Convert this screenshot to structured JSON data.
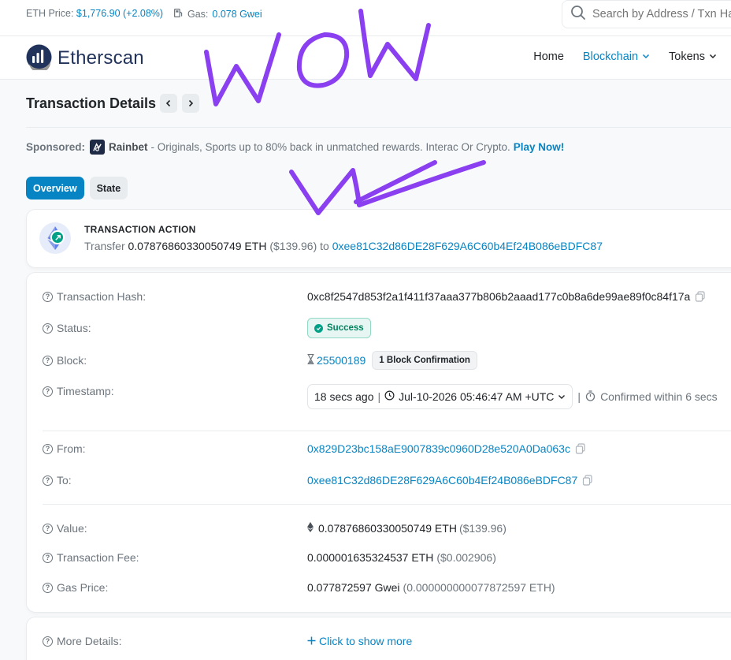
{
  "topbar": {
    "eth_price_label": "ETH Price:",
    "eth_price_value": "$1,776.90 (+2.08%)",
    "gas_label": "Gas:",
    "gas_value": "0.078 Gwei",
    "search_placeholder": "Search by Address / Txn Hash / Block / Token / Domain Name"
  },
  "nav": {
    "logo_text": "Etherscan",
    "items": [
      {
        "label": "Home",
        "active": false,
        "has_dropdown": false
      },
      {
        "label": "Blockchain",
        "active": true,
        "has_dropdown": true
      },
      {
        "label": "Tokens",
        "active": false,
        "has_dropdown": true
      }
    ]
  },
  "page": {
    "title": "Transaction Details"
  },
  "sponsored": {
    "label": "Sponsored:",
    "name": "Rainbet",
    "text": "- Originals, Sports up to 80% back in unmatched rewards. Interac Or Crypto.",
    "cta": "Play Now!"
  },
  "tabs": [
    {
      "label": "Overview",
      "active": true
    },
    {
      "label": "State",
      "active": false
    }
  ],
  "action": {
    "title": "TRANSACTION ACTION",
    "prefix": "Transfer",
    "amount": "0.07876860330050749 ETH",
    "usd": "($139.96)",
    "to_word": "to",
    "to_address": "0xee81C32d86DE28F629A6C60b4Ef24B086eBDFC87"
  },
  "details": {
    "tx_hash_label": "Transaction Hash:",
    "tx_hash": "0xc8f2547d853f2a1f411f37aaa377b806b2aaad177c0b8a6de99ae89f0c84f17a",
    "status_label": "Status:",
    "status": "Success",
    "block_label": "Block:",
    "block": "25500189",
    "block_confirmation": "1 Block Confirmation",
    "timestamp_label": "Timestamp:",
    "timestamp_ago": "18 secs ago",
    "timestamp_date": "Jul-10-2026 05:46:47 AM +UTC",
    "timestamp_confirmed": "Confirmed within 6 secs",
    "from_label": "From:",
    "from": "0x829D23bc158aE9007839c0960D28e520A0Da063c",
    "to_label": "To:",
    "to": "0xee81C32d86DE28F629A6C60b4Ef24B086eBDFC87",
    "value_label": "Value:",
    "value": "0.07876860330050749 ETH",
    "value_usd": "($139.96)",
    "fee_label": "Transaction Fee:",
    "fee": "0.000001635324537 ETH",
    "fee_usd": "($0.002906)",
    "gas_price_label": "Gas Price:",
    "gas_price": "0.077872597 Gwei",
    "gas_price_eth": "(0.000000000077872597 ETH)"
  },
  "more": {
    "label": "More Details:",
    "link": "Click to show more"
  },
  "colors": {
    "link": "#0784c3",
    "success": "#00a186",
    "scribble": "#8a3ff0"
  }
}
